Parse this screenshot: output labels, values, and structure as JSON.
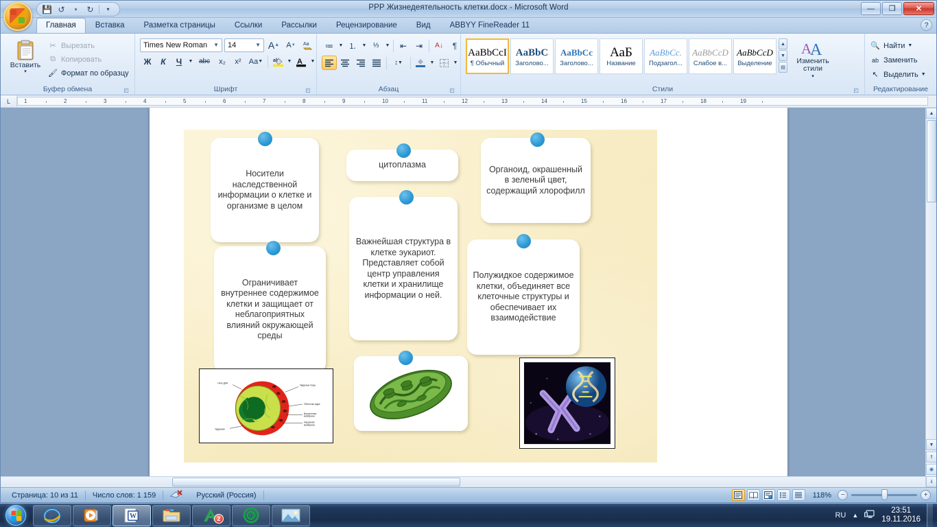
{
  "window": {
    "title": "PPP Жизнедеятельность клетки.docx - Microsoft Word",
    "minimize": "—",
    "restore": "❐",
    "close": "✕",
    "help": "?"
  },
  "quick_access": {
    "save": "💾",
    "undo": "↺",
    "redo": "↻",
    "customize": "▾"
  },
  "tabs": [
    {
      "label": "Главная",
      "active": true
    },
    {
      "label": "Вставка",
      "active": false
    },
    {
      "label": "Разметка страницы",
      "active": false
    },
    {
      "label": "Ссылки",
      "active": false
    },
    {
      "label": "Рассылки",
      "active": false
    },
    {
      "label": "Рецензирование",
      "active": false
    },
    {
      "label": "Вид",
      "active": false
    },
    {
      "label": "ABBYY FineReader 11",
      "active": false
    }
  ],
  "ribbon": {
    "clipboard": {
      "group_label": "Буфер обмена",
      "paste": "Вставить",
      "paste_arrow": "▾",
      "cut": "Вырезать",
      "copy": "Копировать",
      "format_painter": "Формат по образцу"
    },
    "font": {
      "group_label": "Шрифт",
      "font_name": "Times New Roman",
      "font_size": "14",
      "grow": "A",
      "shrink": "A",
      "clear_format": "Aa",
      "bold": "Ж",
      "italic": "К",
      "underline": "Ч",
      "strikethrough": "abc",
      "subscript": "x₂",
      "superscript": "x²",
      "change_case": "Aa",
      "highlight": "ab",
      "font_color": "A"
    },
    "paragraph": {
      "group_label": "Абзац",
      "bullets": "≔",
      "numbering": "⒈",
      "multilevel": "⅓",
      "decrease_indent": "⇤",
      "increase_indent": "⇥",
      "sort": "А↓",
      "show_marks": "¶",
      "align_left": "≡",
      "align_center": "≡",
      "align_right": "≡",
      "justify": "≡",
      "line_spacing": "↕",
      "shading": "▨",
      "borders": "⊞"
    },
    "styles": {
      "group_label": "Стили",
      "items": [
        {
          "preview": "AaBbCcI",
          "name": "¶ Обычный",
          "selected": true
        },
        {
          "preview": "AaBbC",
          "name": "Заголово...",
          "selected": false
        },
        {
          "preview": "AaBbCc",
          "name": "Заголово...",
          "selected": false
        },
        {
          "preview": "АаБ",
          "name": "Название",
          "selected": false
        },
        {
          "preview": "AaBbCc.",
          "name": "Подзагол...",
          "selected": false
        },
        {
          "preview": "AaBbCcD",
          "name": "Слабое в...",
          "selected": false
        },
        {
          "preview": "AaBbCcD",
          "name": "Выделение",
          "selected": false
        }
      ],
      "scroll_up": "▲",
      "scroll_down": "▼",
      "more": "▤",
      "change_styles": "Изменить стили",
      "change_styles_arrow": "▾"
    },
    "editing": {
      "group_label": "Редактирование",
      "find": "Найти",
      "replace": "Заменить",
      "select": "Выделить",
      "arrow": "▾"
    }
  },
  "ruler": {
    "tab_selector": "L",
    "marks": [
      "1",
      "2",
      "3",
      "4",
      "5",
      "6",
      "7",
      "8",
      "9",
      "10",
      "11",
      "12",
      "13",
      "14",
      "15",
      "16",
      "17",
      "18",
      "19"
    ]
  },
  "document": {
    "boxes": [
      {
        "id": "box-heredity",
        "text": "Носители наследственной информации о клетке и организме в целом"
      },
      {
        "id": "box-cytoplasm-label",
        "text": "цитоплазма"
      },
      {
        "id": "box-chloroplast",
        "text": "Органоид, окрашенный в зеленый цвет, содержащий хлорофилл"
      },
      {
        "id": "box-nucleus",
        "text": "Важнейшая структура в клетке эукариот. Представляет собой центр управления клетки и хранилище информации о ней."
      },
      {
        "id": "box-membrane",
        "text": "Ограничивает внутреннее содержимое клетки и защищает от неблагоприятных влияний окружающей среды"
      },
      {
        "id": "box-cytoplasm-def",
        "text": "Полужидкое содержимое клетки, объединяет все клеточные структуры и обеспечивает их взаимодействие"
      }
    ],
    "images": [
      {
        "id": "image-nucleus-diagram",
        "alt": "Схема ядра клетки"
      },
      {
        "id": "image-chloroplast",
        "alt": "Хлоропласт"
      },
      {
        "id": "image-chromosome-dna",
        "alt": "Хромосома и ДНК"
      }
    ]
  },
  "statusbar": {
    "page": "Страница: 10 из 11",
    "words": "Число слов: 1 159",
    "proofing_icon": "proofing-errors-icon",
    "language": "Русский (Россия)",
    "views": [
      "Разметка страницы",
      "Режим чтения",
      "Веб-документ",
      "Структура",
      "Черновик"
    ],
    "zoom": "118%",
    "zoom_out": "−",
    "zoom_in": "+"
  },
  "taskbar": {
    "start": "start-orb",
    "items": [
      {
        "name": "internet-explorer",
        "badge": ""
      },
      {
        "name": "media-player",
        "badge": ""
      },
      {
        "name": "microsoft-word",
        "badge": ""
      },
      {
        "name": "file-explorer",
        "badge": ""
      },
      {
        "name": "abbyy-finereader",
        "badge": "2"
      },
      {
        "name": "mail-client",
        "badge": ""
      },
      {
        "name": "photo-viewer",
        "badge": ""
      }
    ],
    "language": "RU",
    "tray_expand": "▲",
    "network_icon": "network-icon",
    "time": "23:51",
    "date": "19.11.2016"
  },
  "colors": {
    "accent_blue": "#2e9bd6",
    "ribbon_bg": "#e2ecf8",
    "page_bg": "#f7ecc4",
    "close_red": "#c8372a"
  }
}
